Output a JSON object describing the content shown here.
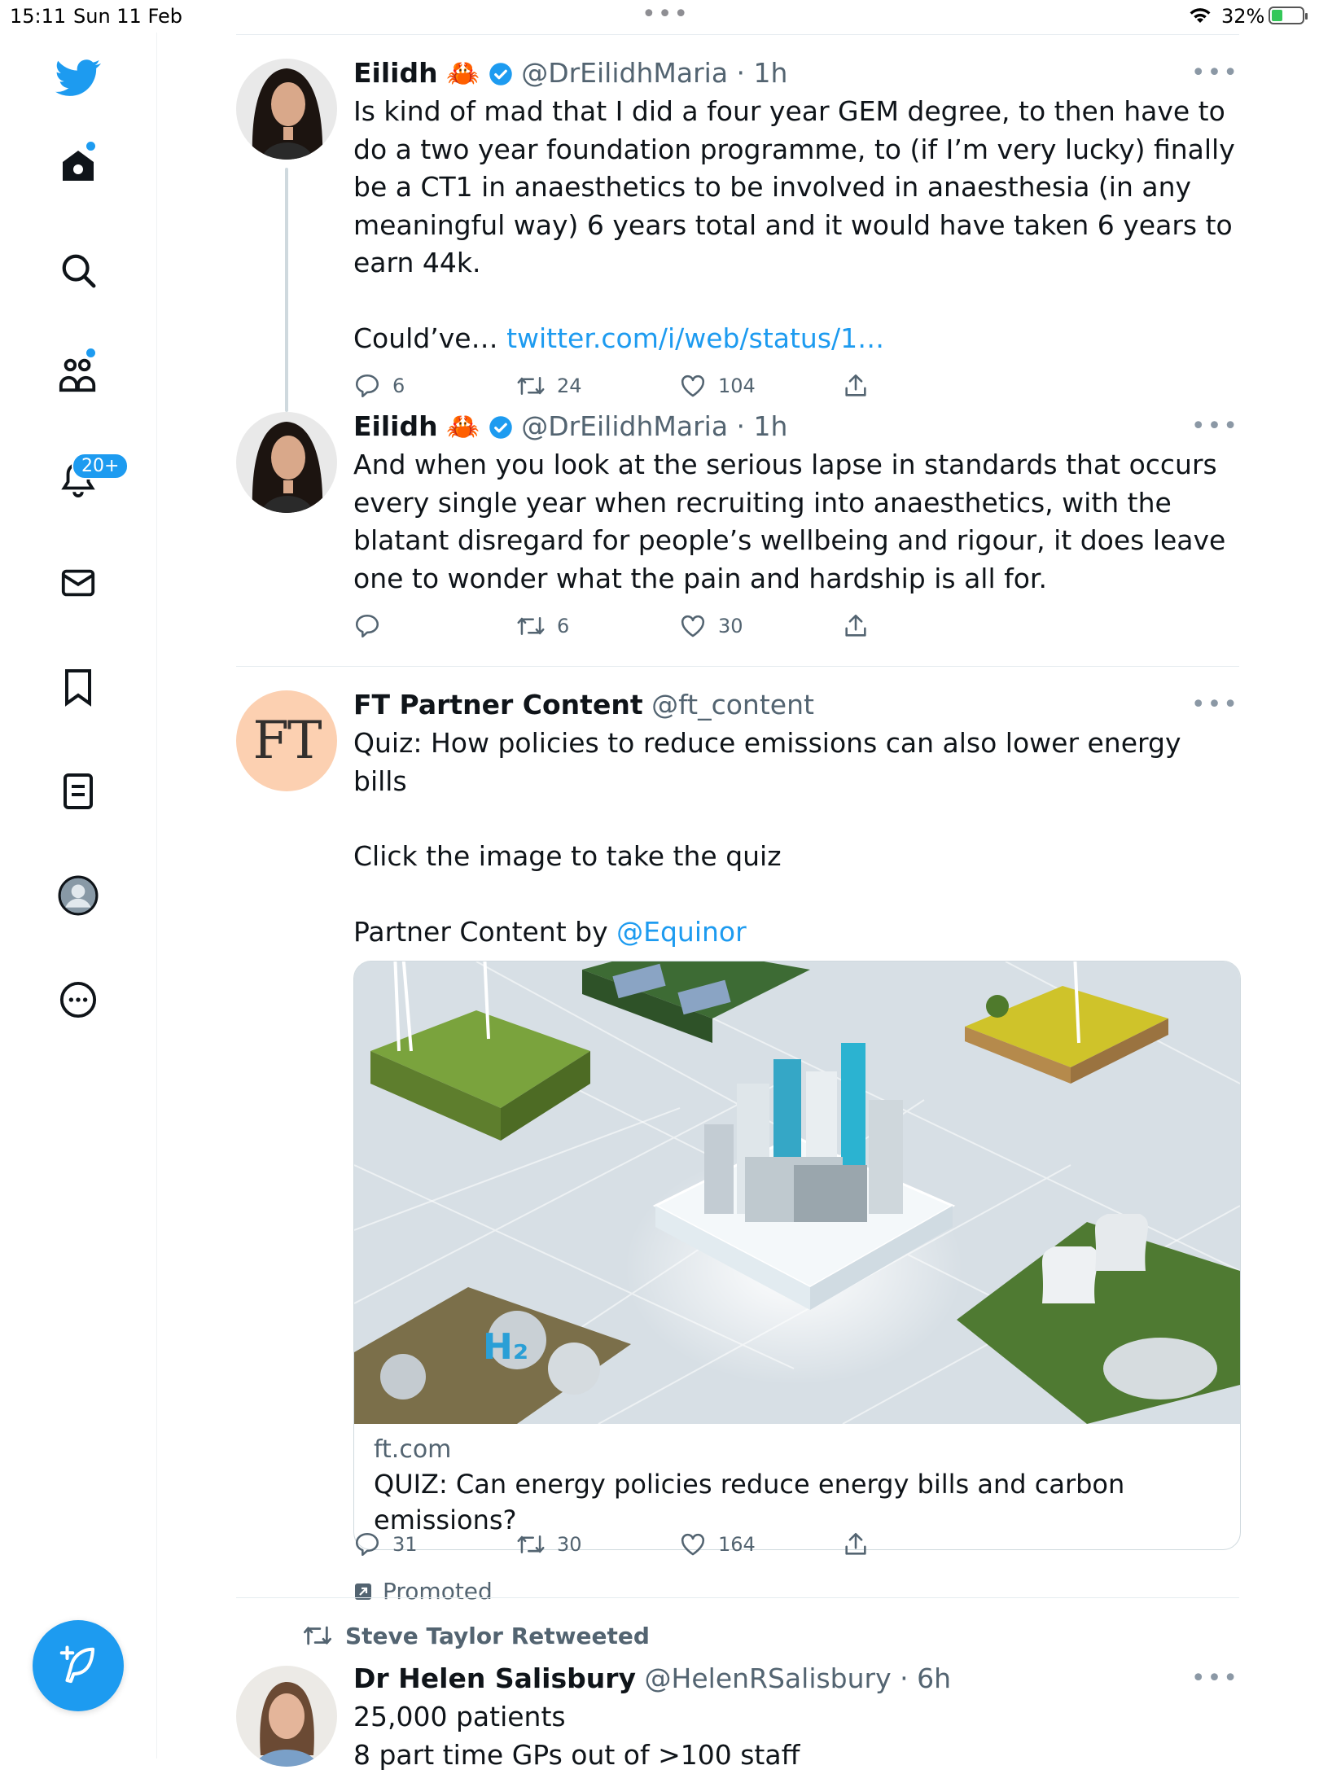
{
  "status_bar": {
    "time": "15:11",
    "date": "Sun 11 Feb",
    "battery": "32%",
    "battery_level": 0.32
  },
  "sidebar": {
    "notifications_badge": "20+"
  },
  "tweets": [
    {
      "name": "Eilidh",
      "emoji": "🦀",
      "handle": "@DrEilidhMaria",
      "time": "· 1h",
      "text": "Is kind of mad that I did a four year GEM degree, to then have to do a two year foundation programme, to (if I’m very lucky) finally be a CT1 in anaesthetics to be involved in anaesthesia (in any meaningful way) 6 years total and it would have taken 6 years to earn 44k.",
      "text2": "Could’ve… ",
      "link": "twitter.com/i/web/status/1…",
      "replies": "6",
      "retweets": "24",
      "likes": "104"
    },
    {
      "name": "Eilidh",
      "emoji": "🦀",
      "handle": "@DrEilidhMaria",
      "time": "· 1h",
      "text": "And when you look at the serious lapse in standards that occurs every single year when recruiting into anaesthetics, with the blatant disregard for people’s wellbeing and rigour, it does leave one to wonder what the pain and hardship is all for.",
      "replies": "",
      "retweets": "6",
      "likes": "30"
    },
    {
      "name": "FT Partner Content",
      "handle": "@ft_content",
      "avatar_text": "FT",
      "text": "Quiz: How policies to reduce emissions can also lower energy bills",
      "text2": "Click the image to take the quiz",
      "text3": "Partner Content by ",
      "mention": "@Equinor",
      "card_domain": "ft.com",
      "card_title": "QUIZ: Can energy policies reduce energy bills and carbon emissions?",
      "replies": "31",
      "retweets": "30",
      "likes": "164",
      "promoted": "Promoted"
    },
    {
      "retweeted_by": "Steve Taylor Retweeted",
      "name": "Dr Helen Salisbury",
      "handle": "@HelenRSalisbury",
      "time": "· 6h",
      "text": "25,000 patients",
      "text2": "8 part time GPs out of >100 staff"
    }
  ],
  "colors": {
    "accent": "#1d9bf0",
    "text": "#0f1419",
    "muted": "#536471",
    "ft_avatar": "#fcd0b1"
  }
}
